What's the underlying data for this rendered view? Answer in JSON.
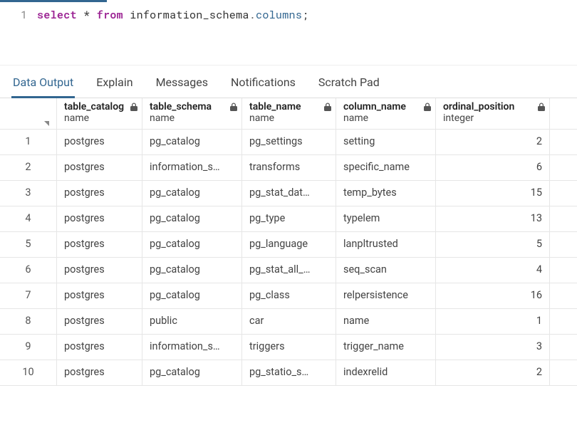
{
  "editor": {
    "line_number": "1",
    "tokens": {
      "select": "select",
      "star": "*",
      "from": "from",
      "schema": "information_schema",
      "dot": ".",
      "table": "columns",
      "semi": ";"
    }
  },
  "tabs": {
    "data_output": "Data Output",
    "explain": "Explain",
    "messages": "Messages",
    "notifications": "Notifications",
    "scratch_pad": "Scratch Pad"
  },
  "columns": [
    {
      "title": "table_catalog",
      "type": "name"
    },
    {
      "title": "table_schema",
      "type": "name"
    },
    {
      "title": "table_name",
      "type": "name"
    },
    {
      "title": "column_name",
      "type": "name"
    },
    {
      "title": "ordinal_position",
      "type": "integer"
    }
  ],
  "rows": [
    {
      "n": "1",
      "catalog": "postgres",
      "schema": "pg_catalog",
      "table": "pg_settings",
      "column": "setting",
      "ordinal": "2"
    },
    {
      "n": "2",
      "catalog": "postgres",
      "schema": "information_s…",
      "table": "transforms",
      "column": "specific_name",
      "ordinal": "6"
    },
    {
      "n": "3",
      "catalog": "postgres",
      "schema": "pg_catalog",
      "table": "pg_stat_dat…",
      "column": "temp_bytes",
      "ordinal": "15"
    },
    {
      "n": "4",
      "catalog": "postgres",
      "schema": "pg_catalog",
      "table": "pg_type",
      "column": "typelem",
      "ordinal": "13"
    },
    {
      "n": "5",
      "catalog": "postgres",
      "schema": "pg_catalog",
      "table": "pg_language",
      "column": "lanpltrusted",
      "ordinal": "5"
    },
    {
      "n": "6",
      "catalog": "postgres",
      "schema": "pg_catalog",
      "table": "pg_stat_all_…",
      "column": "seq_scan",
      "ordinal": "4"
    },
    {
      "n": "7",
      "catalog": "postgres",
      "schema": "pg_catalog",
      "table": "pg_class",
      "column": "relpersistence",
      "ordinal": "16"
    },
    {
      "n": "8",
      "catalog": "postgres",
      "schema": "public",
      "table": "car",
      "column": "name",
      "ordinal": "1"
    },
    {
      "n": "9",
      "catalog": "postgres",
      "schema": "information_s…",
      "table": "triggers",
      "column": "trigger_name",
      "ordinal": "3"
    },
    {
      "n": "10",
      "catalog": "postgres",
      "schema": "pg_catalog",
      "table": "pg_statio_s…",
      "column": "indexrelid",
      "ordinal": "2"
    }
  ]
}
